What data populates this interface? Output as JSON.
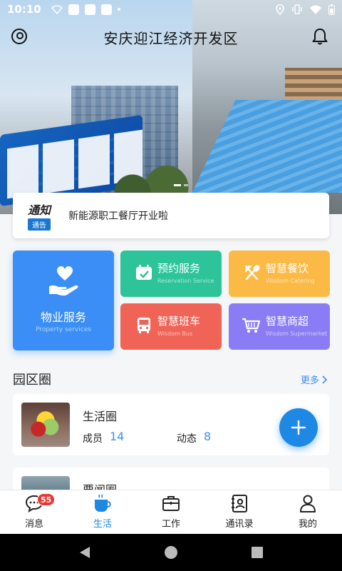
{
  "status_bar": {
    "time": "10:10"
  },
  "header": {
    "title": "安庆迎江经济开发区"
  },
  "notice": {
    "tag_top": "通知",
    "tag_bottom": "通告",
    "text": "新能源职工餐厅开业啦"
  },
  "services": {
    "property": {
      "name": "物业服务",
      "sub": "Property services"
    },
    "reservation": {
      "name": "预约服务",
      "sub": "Reservation Service"
    },
    "catering": {
      "name": "智慧餐饮",
      "sub": "Wisdom Catering"
    },
    "bus": {
      "name": "智慧班车",
      "sub": "Wisdom Bus"
    },
    "supermarket": {
      "name": "智慧商超",
      "sub": "Wisdom Supermarket"
    }
  },
  "section": {
    "title": "园区圈",
    "more": "更多"
  },
  "circles": [
    {
      "name": "生活圈",
      "members_label": "成员",
      "members": "14",
      "posts_label": "动态",
      "posts": "8"
    },
    {
      "name": "要闻圈"
    }
  ],
  "nav": {
    "items": [
      {
        "label": "消息",
        "badge": "55"
      },
      {
        "label": "生活"
      },
      {
        "label": "工作"
      },
      {
        "label": "通讯录"
      },
      {
        "label": "我的"
      }
    ]
  },
  "colors": {
    "accent": "#1e88e5",
    "reservation": "#2ec49a",
    "catering": "#fbba45",
    "bus": "#f06458",
    "supermarket": "#8a7cf5"
  }
}
